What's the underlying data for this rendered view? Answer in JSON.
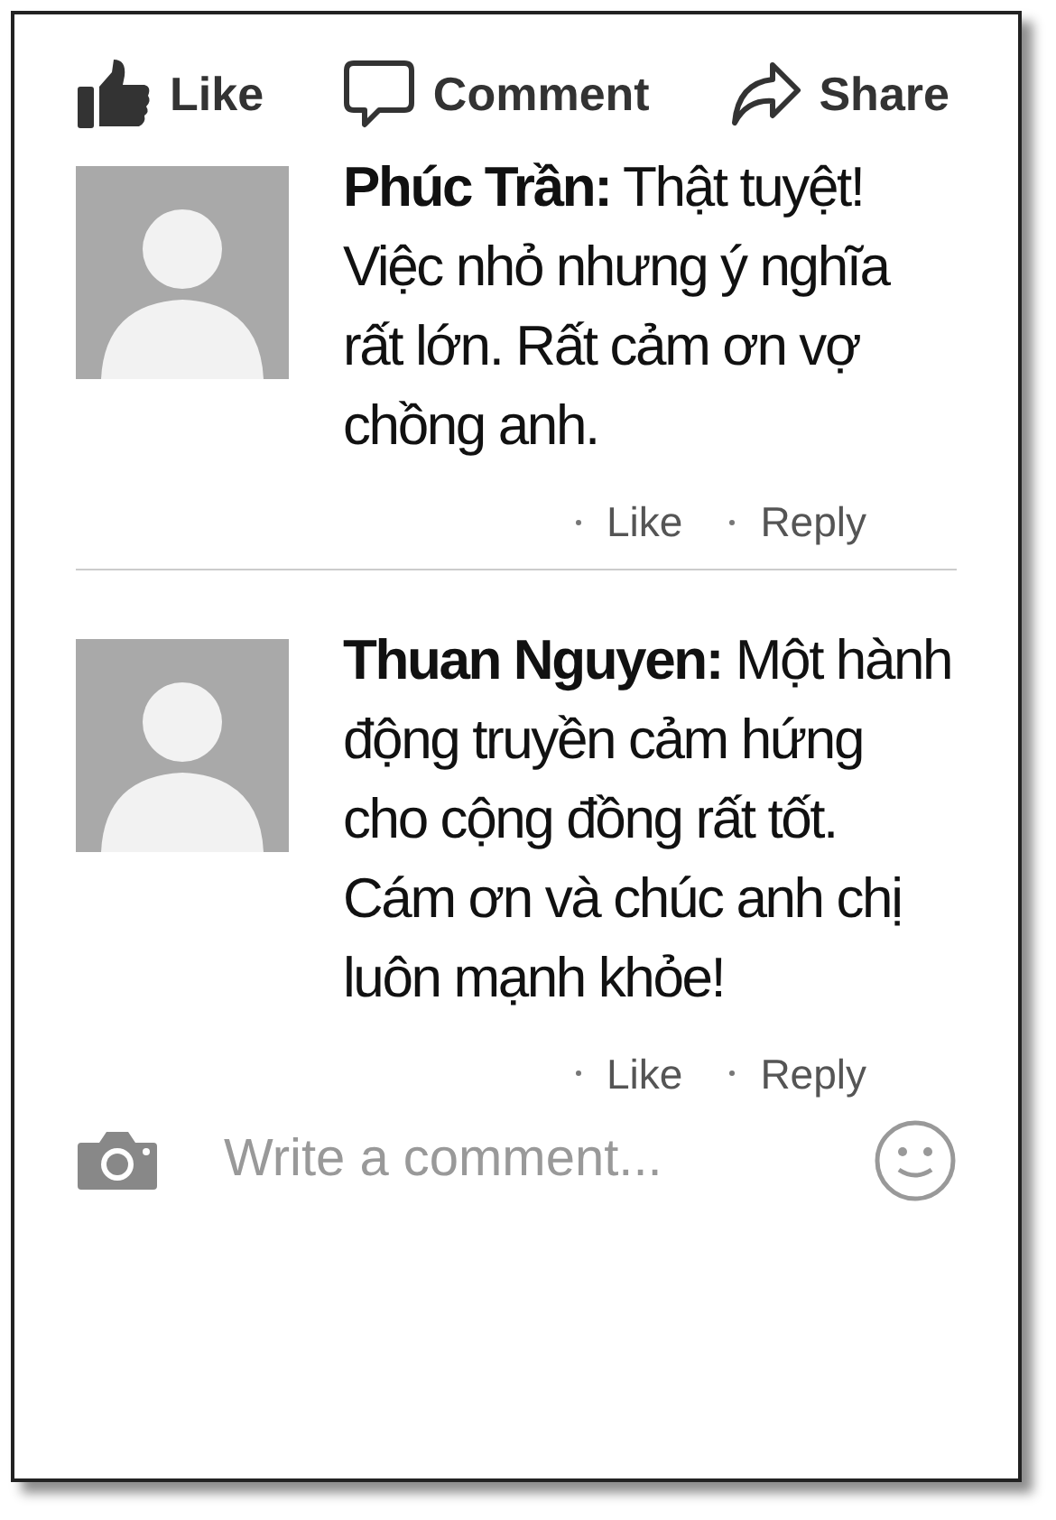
{
  "actions": [
    {
      "kind": "like",
      "label": "Like"
    },
    {
      "kind": "comment",
      "label": "Comment"
    },
    {
      "kind": "share",
      "label": "Share"
    }
  ],
  "comments": [
    {
      "text": "**Phúc Trần:** Thật tuyệt! Việc nhỏ nhưng ý nghĩa rất lớn. Rất cảm ơn vợ chồng anh.",
      "like": "Like",
      "reply": "Reply"
    },
    {
      "text": "**Thuan Nguyen:** Một hành động truyền cảm hứng cho cộng đồng rất tốt. Cám ơn và chúc anh chị luôn mạnh khỏe!",
      "like": "Like",
      "reply": "Reply"
    }
  ],
  "composer": {
    "placeholder": "Write a comment..."
  }
}
